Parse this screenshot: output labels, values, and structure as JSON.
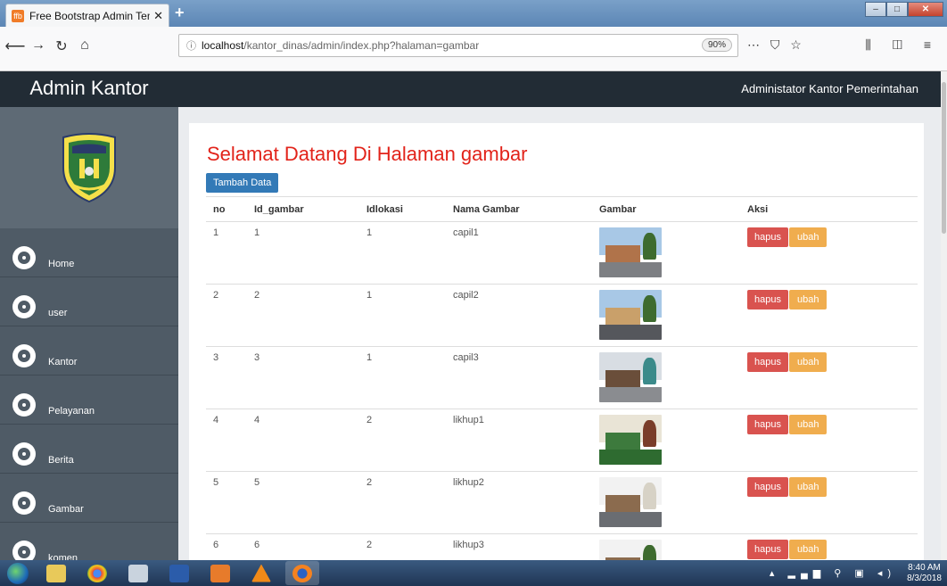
{
  "browser": {
    "tab_title": "Free Bootstrap Admin Templat",
    "tab_favicon": "ffb",
    "url_host": "localhost",
    "url_path": "/kantor_dinas/admin/index.php?halaman=gambar",
    "zoom": "90%"
  },
  "header": {
    "brand": "Admin Kantor",
    "user": "Administator Kantor Pemerintahan"
  },
  "sidebar": {
    "items": [
      {
        "label": "Home",
        "icon": "dashboard-icon"
      },
      {
        "label": "user",
        "icon": "dashboard-icon"
      },
      {
        "label": "Kantor",
        "icon": "dashboard-icon"
      },
      {
        "label": "Pelayanan",
        "icon": "dashboard-icon"
      },
      {
        "label": "Berita",
        "icon": "dashboard-icon"
      },
      {
        "label": "Gambar",
        "icon": "dashboard-icon"
      },
      {
        "label": "komen",
        "icon": "dashboard-icon"
      }
    ]
  },
  "main": {
    "title": "Selamat Datang Di Halaman gambar",
    "add_button": "Tambah Data",
    "columns": [
      "no",
      "Id_gambar",
      "Idlokasi",
      "Nama Gambar",
      "Gambar",
      "Aksi"
    ],
    "rows": [
      {
        "no": "1",
        "id_gambar": "1",
        "idlokasi": "1",
        "nama": "capil1"
      },
      {
        "no": "2",
        "id_gambar": "2",
        "idlokasi": "1",
        "nama": "capil2"
      },
      {
        "no": "3",
        "id_gambar": "3",
        "idlokasi": "1",
        "nama": "capil3"
      },
      {
        "no": "4",
        "id_gambar": "4",
        "idlokasi": "2",
        "nama": "likhup1"
      },
      {
        "no": "5",
        "id_gambar": "5",
        "idlokasi": "2",
        "nama": "likhup2"
      },
      {
        "no": "6",
        "id_gambar": "6",
        "idlokasi": "2",
        "nama": "likhup3"
      }
    ],
    "delete_label": "hapus",
    "edit_label": "ubah"
  },
  "taskbar": {
    "time": "8:40 AM",
    "date": "8/3/2018"
  }
}
